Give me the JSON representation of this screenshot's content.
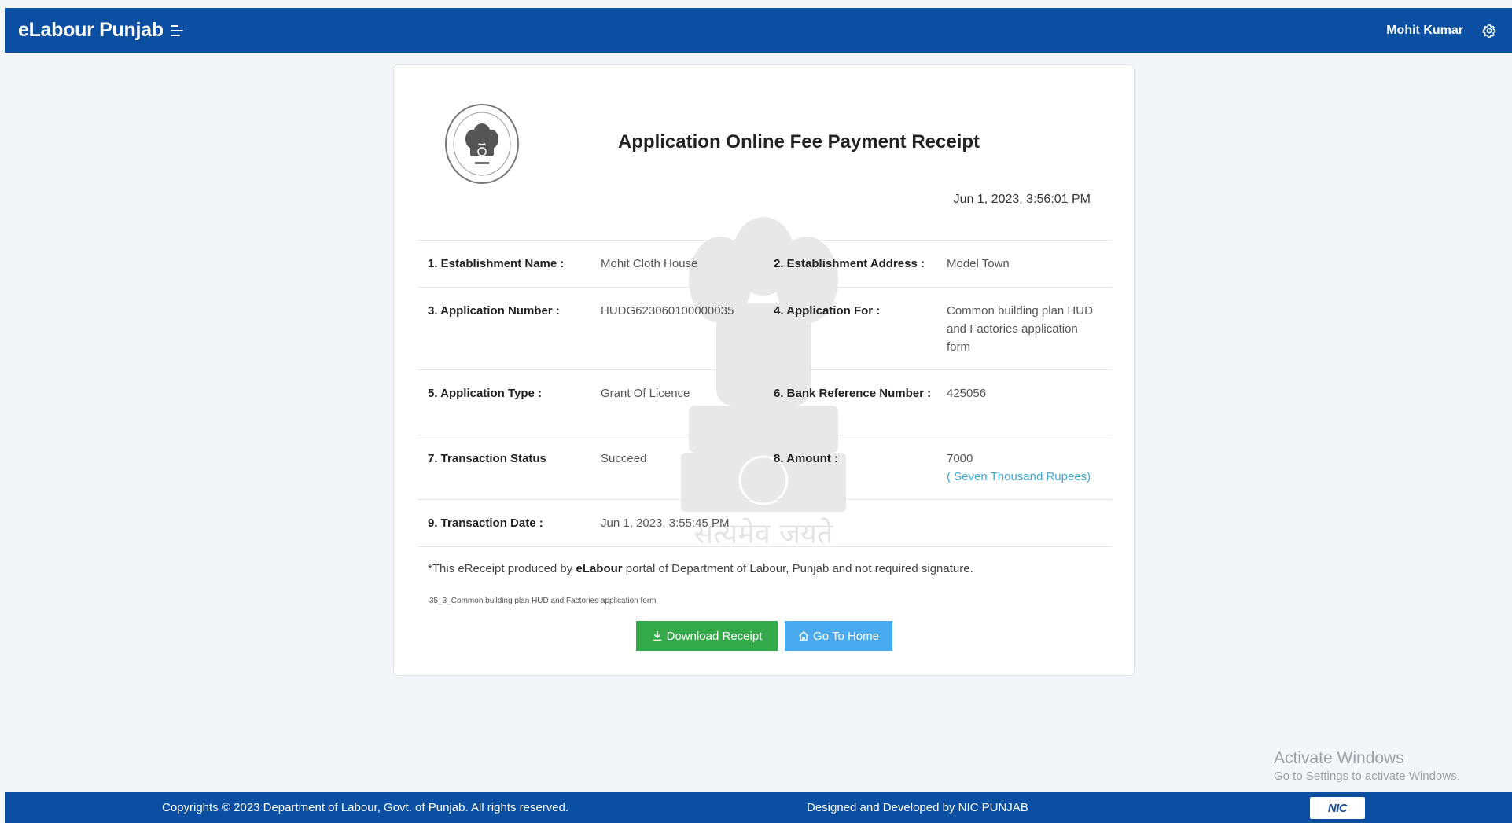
{
  "header": {
    "brand": "eLabour Punjab",
    "user_name": "Mohit Kumar",
    "menu_icon": "menu-toggle-icon",
    "settings_icon": "gear-icon",
    "color": "#0b4fa2"
  },
  "receipt": {
    "title": "Application Online Fee Payment Receipt",
    "datetime": "Jun 1, 2023, 3:56:01 PM",
    "rows": [
      {
        "label1": "1. Establishment Name :",
        "value1": "Mohit Cloth House",
        "label2": "2. Establishment Address :",
        "value2": "Model Town"
      },
      {
        "label1": "3. Application Number :",
        "value1": "HUDG623060100000035",
        "label2": "4. Application For :",
        "value2": "Common building plan HUD and Factories application form"
      },
      {
        "label1": "5. Application Type :",
        "value1": "Grant Of Licence",
        "label2": "6. Bank Reference Number :",
        "value2": "425056"
      },
      {
        "label1": "7. Transaction Status",
        "value1": "Succeed",
        "label2": "8. Amount :",
        "value2": "7000",
        "value2_words": "( Seven Thousand Rupees)"
      },
      {
        "label1": "9. Transaction Date :",
        "value1": "Jun 1, 2023, 3:55:45 PM"
      }
    ],
    "note_prefix": "*This eReceipt produced by ",
    "note_bold": "eLabour",
    "note_suffix": " portal of Department of Labour, Punjab and not required signature.",
    "reference": "35_3_Common building plan HUD and Factories application form",
    "download_label": "Download Receipt",
    "home_label": "Go To Home",
    "download_color": "#34a94a",
    "home_color": "#4aaaf0"
  },
  "watermark_motto": "सत्यमेव जयते",
  "os_overlay": {
    "title": "Activate Windows",
    "subtitle": "Go to Settings to activate Windows."
  },
  "footer": {
    "copyright": "Copyrights © 2023 Department of Labour, Govt. of Punjab. All rights reserved.",
    "designed_by": "Designed and Developed by NIC PUNJAB",
    "nic_logo": "NIC"
  }
}
